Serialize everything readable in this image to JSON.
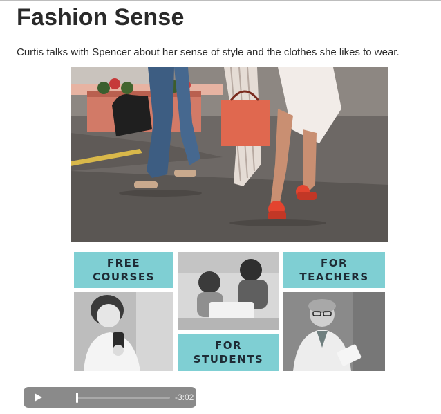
{
  "page": {
    "title": "Fashion Sense",
    "intro": "Curtis talks with Spencer about her sense of style and the clothes she likes to wear."
  },
  "promo": {
    "free_courses": "FREE\nCOURSES",
    "for_teachers": "FOR\nTEACHERS",
    "for_students": "FOR\nSTUDENTS",
    "teal_color": "#7fcfd3"
  },
  "player": {
    "time_remaining": "-3:02",
    "progress": 0.0,
    "play_icon": "play-icon"
  }
}
